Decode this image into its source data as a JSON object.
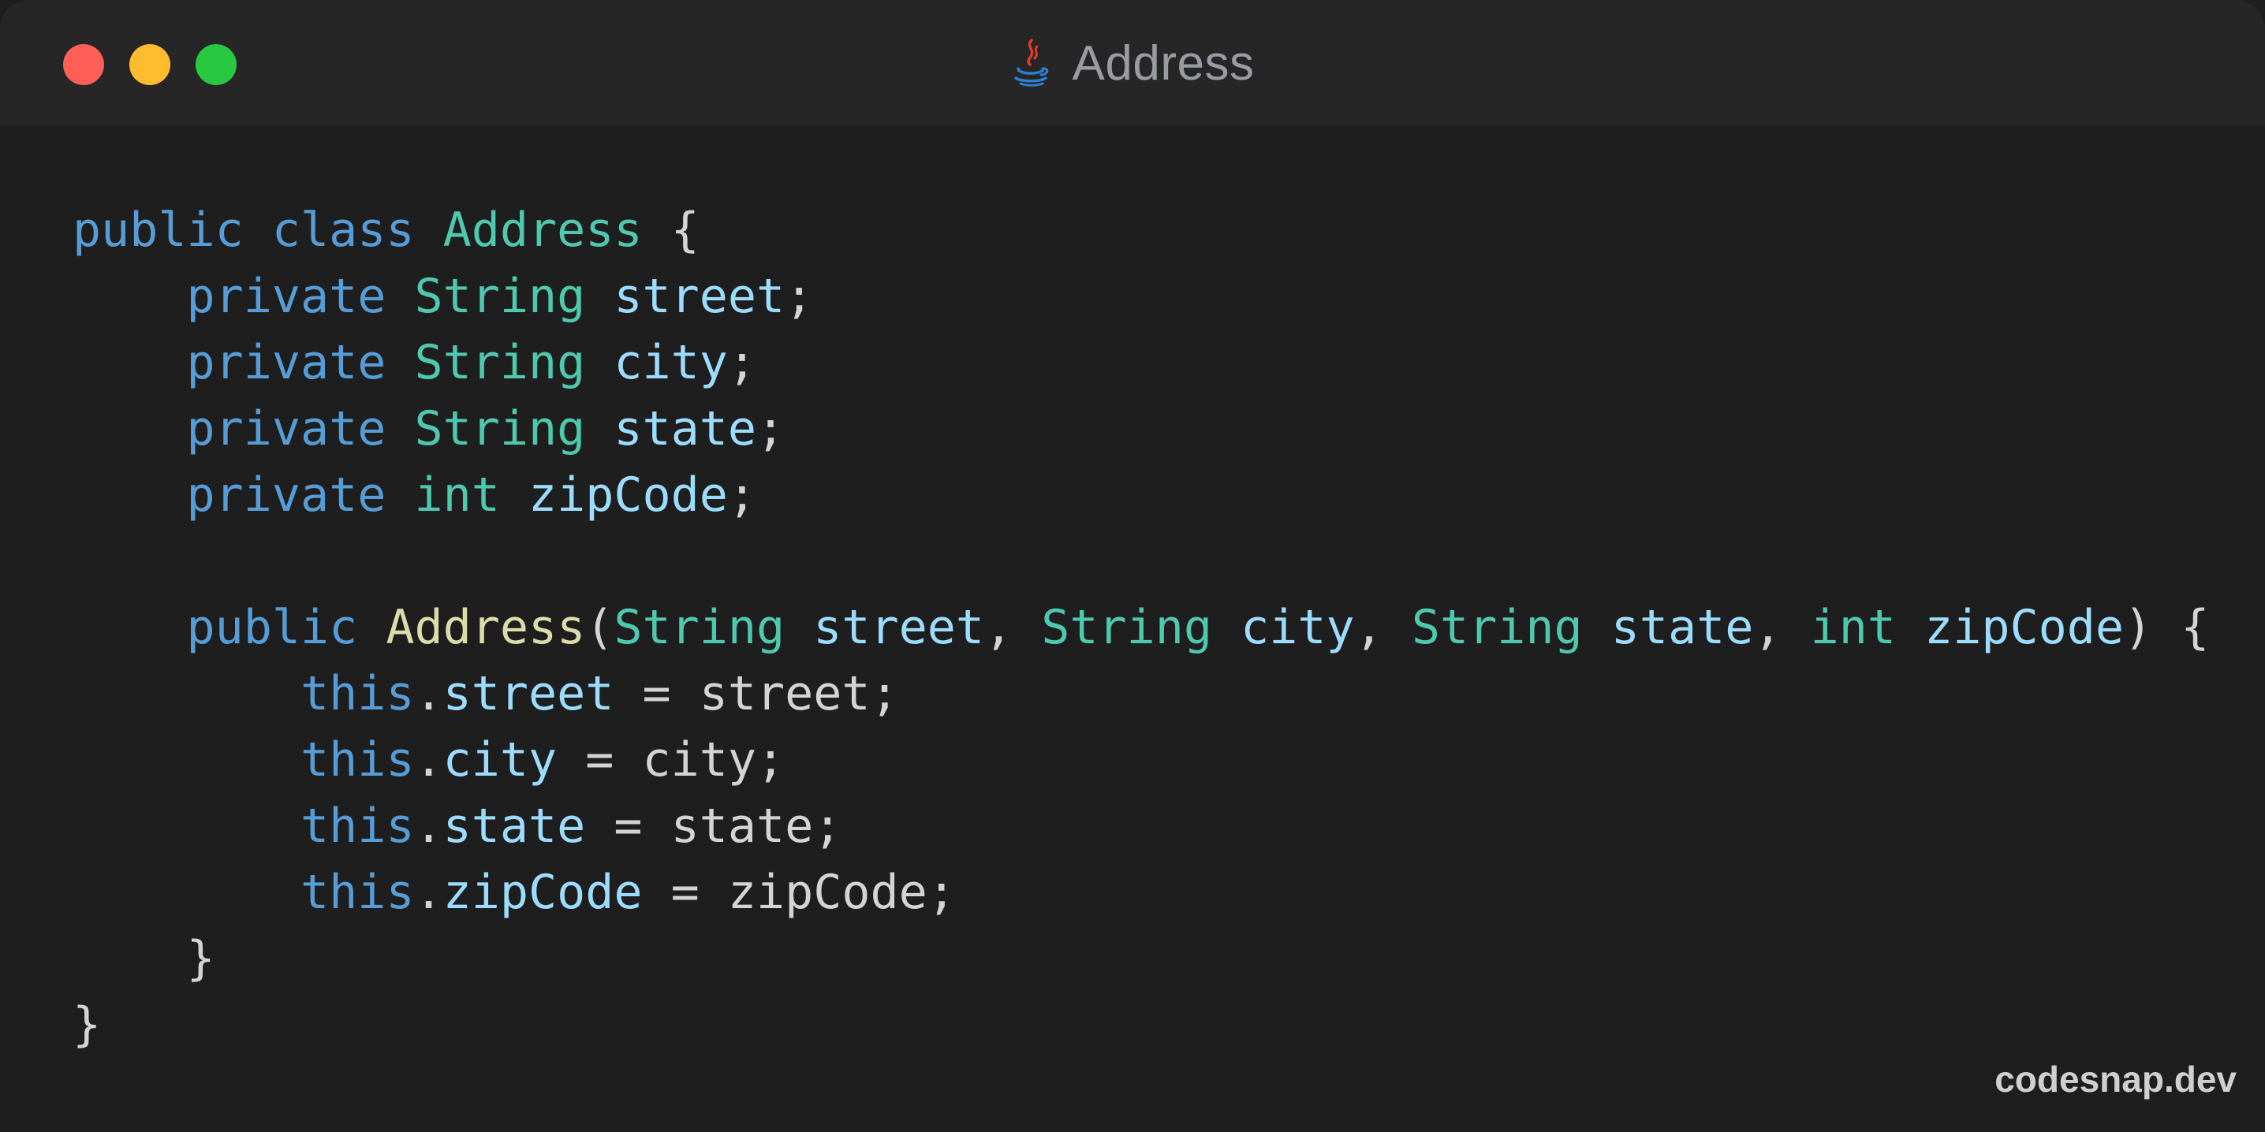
{
  "window": {
    "title": "Address",
    "title_icon": "java-cup-icon",
    "traffic_lights": [
      "#ff5f57",
      "#febc2e",
      "#28c840"
    ]
  },
  "colors": {
    "keyword": "#569cd6",
    "type": "#4ec9b0",
    "variable": "#9cdcfe",
    "function": "#dcdcaa",
    "punctuation": "#d4d4d4",
    "background": "#1e1e1e"
  },
  "code": {
    "l1": {
      "kw1": "public",
      "kw2": "class",
      "name": "Address",
      "brace": "{"
    },
    "l2": {
      "kw": "private",
      "type": "String",
      "name": "street",
      "end": ";"
    },
    "l3": {
      "kw": "private",
      "type": "String",
      "name": "city",
      "end": ";"
    },
    "l4": {
      "kw": "private",
      "type": "String",
      "name": "state",
      "end": ";"
    },
    "l5": {
      "kw": "private",
      "type": "int",
      "name": "zipCode",
      "end": ";"
    },
    "l7": {
      "kw": "public",
      "fn": "Address",
      "open": "(",
      "t1": "String",
      "p1": "street",
      "c1": ",",
      "t2": "String",
      "p2": "city",
      "c2": ",",
      "t3": "String",
      "p3": "state",
      "c3": ",",
      "t4": "int",
      "p4": "zipCode",
      "close": ")",
      "brace": "{"
    },
    "l8": {
      "this": "this",
      "dot": ".",
      "field": "street",
      "assign": "=",
      "value": "street",
      "end": ";"
    },
    "l9": {
      "this": "this",
      "dot": ".",
      "field": "city",
      "assign": "=",
      "value": "city",
      "end": ";"
    },
    "l10": {
      "this": "this",
      "dot": ".",
      "field": "state",
      "assign": "=",
      "value": "state",
      "end": ";"
    },
    "l11": {
      "this": "this",
      "dot": ".",
      "field": "zipCode",
      "assign": "=",
      "value": "zipCode",
      "end": ";"
    },
    "l12": {
      "brace": "}"
    },
    "l13": {
      "brace": "}"
    }
  },
  "watermark": "codesnap.dev"
}
